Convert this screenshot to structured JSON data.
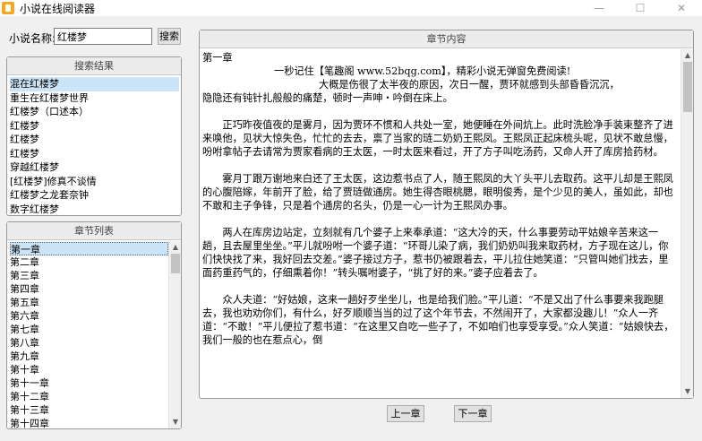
{
  "window": {
    "title": "小说在线阅读器",
    "controls": [
      "—",
      "☐",
      "✕"
    ]
  },
  "search": {
    "label": "小说名称:",
    "value": "红楼梦",
    "button": "搜索"
  },
  "results": {
    "header": "搜索结果",
    "items": [
      "混在红楼梦",
      "重生在红楼梦世界",
      "红楼梦（口述本）",
      "红楼梦",
      "红楼梦",
      "红楼梦",
      "穿越红楼梦",
      "[红楼梦]修真不谈情",
      "红楼梦之龙套奈钟",
      "数字红楼梦"
    ]
  },
  "chapters": {
    "header": "章节列表",
    "items": [
      "第一章",
      "第二章",
      "第三章",
      "第四章",
      "第五章",
      "第六章",
      "第七章",
      "第八章",
      "第九章",
      "第十章",
      "第十一章",
      "第十二章",
      "第十三章",
      "第十四章"
    ]
  },
  "content": {
    "header": "章节内容",
    "chapter_title": "第一章",
    "intro1": "一秒记住【笔趣阁 www.52bqg.com】，精彩小说无弹窗免费阅读!",
    "intro2": "大概是伤很了太半夜的原因，次日一醒，贾环就感到头部昏昏沉沉，",
    "intro3": "隐隐还有钝针扎般般的痛楚，顿时一声呻・吟倒在床上。",
    "p1": "正巧昨夜值夜的是雾月，因为贾环不惯和人共处一室，她便睡在外间炕上。此时洗脸净手装束整齐了进来唤他，见状大惊失色，忙忙的去去，禀了当家的琏二奶奶王熙凤。王熙凤正起床梳头呢，见状不敢怠慢，吩咐拿帖子去请常为贾家看病的王太医，一时太医来看过，开了方子叫吃汤药，又命人开了库房拾药材。",
    "p2": "雾月丁跟万谢地来白还了王太医，这边惹书点了人，随王熙凤的大丫头平儿去取药。这平儿却是王熙凤的心腹陪嫁，年前开了脸，给了贾琏做通房。她生得杏眼桃腮，眼明俊秀，是个少见的美人，虽如此，却也不敢和主子争锋，只是着个通房的名头，仍是一心一计为王熙凤办事。",
    "p3": "两人在库房边站定，立刻就有几个婆子上来奉承道：“这大冷的天，什么事要劳动平姑娘辛苦来这一趟，且去屋里坐坐。”平儿就吩咐一个婆子道：“环哥儿染了病，我们奶奶叫我来取药材，方子现在这儿，你们快快找了来，我好回去交差。”婆子接过方子，惹书仍被跟着去，平儿拉住她笑道：“只管叫她们找去，里面药重药气的，仔细熏着你！”转头嘱咐婆子，“挑了好的来。”婆子应着去了。",
    "p4": "众人夫道：“好姑娘，这来一趟好歹坐坐儿，也是给我们脸。”平儿道：“不是又出了什么事要来我跑腿去，我也劝劝你们，有什么，好歹顺顺当当的过了这个年节去，不然闹开了，大家都没趣儿！”众人一齐道：“不敢！”平儿便拉了惹书道：“在这里又自吃一些子了，不如咱们也享受享受。”众人笑道：“姑娘快去，我们一般的也在惹点心，倒"
  },
  "nav": {
    "prev": "上一章",
    "next": "下一章"
  },
  "colors": {
    "selection": "#cce4f7",
    "app_icon": "#f5a623"
  }
}
